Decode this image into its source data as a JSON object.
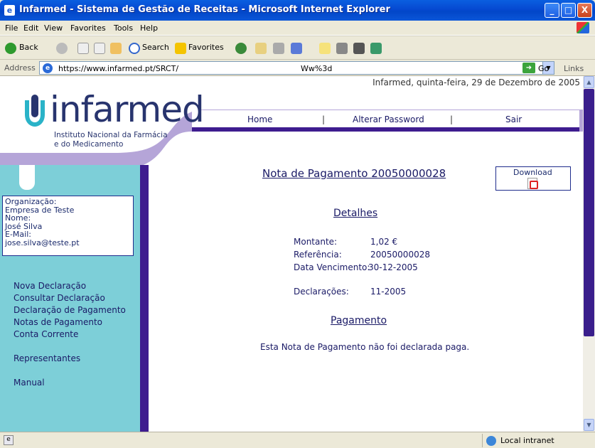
{
  "window": {
    "title": "Infarmed - Sistema de Gestão de Receitas - Microsoft Internet Explorer",
    "btn_min": "_",
    "btn_max": "□",
    "btn_close": "X"
  },
  "menu": [
    "File",
    "Edit",
    "View",
    "Favorites",
    "Tools",
    "Help"
  ],
  "toolbar": {
    "back": "Back",
    "search": "Search",
    "favorites": "Favorites"
  },
  "address": {
    "label": "Address",
    "url": "https://www.infarmed.pt/SRCT/",
    "url_tail": "Ww%3d",
    "go": "Go",
    "links": "Links"
  },
  "site": {
    "date_line": "Infarmed, quinta-feira, 29 de Dezembro de 2005",
    "logo_word": "infarmed",
    "logo_sub1": "Instituto Nacional da Farmácia",
    "logo_sub2": "e do Medicamento",
    "nav": {
      "home": "Home",
      "sep": "|",
      "change_password": "Alterar Password",
      "exit": "Sair"
    },
    "user": {
      "org_label": "Organização:",
      "org_value": "Empresa de Teste",
      "name_label": "Nome:",
      "name_value": "José Silva",
      "email_label": "E-Mail:",
      "email_value": "jose.silva@teste.pt"
    },
    "sidebar": {
      "nova_declaracao": "Nova Declaração",
      "consultar_declaracao": "Consultar Declaração",
      "declaracao_pagamento": "Declaração de Pagamento",
      "notas_pagamento": "Notas de Pagamento",
      "conta_corrente": "Conta Corrente",
      "representantes": "Representantes",
      "manual": "Manual"
    },
    "main": {
      "title": "Nota de Pagamento 20050000028",
      "download": "Download",
      "details_title": "Detalhes",
      "montante_label": "Montante:",
      "montante_value": "1,02 €",
      "referencia_label": "Referência:",
      "referencia_value": "20050000028",
      "vencimento_label": "Data Vencimento:",
      "vencimento_value": "30-12-2005",
      "declaracoes_label": "Declarações:",
      "declaracoes_value": "11-2005",
      "payment_title": "Pagamento",
      "payment_text": "Esta Nota de Pagamento não foi declarada paga."
    }
  },
  "status": {
    "zone": "Local intranet"
  },
  "colors": {
    "sidebar": "#7dcfd8",
    "purple": "#3e1c8f",
    "text_blue": "#1a1a66"
  }
}
